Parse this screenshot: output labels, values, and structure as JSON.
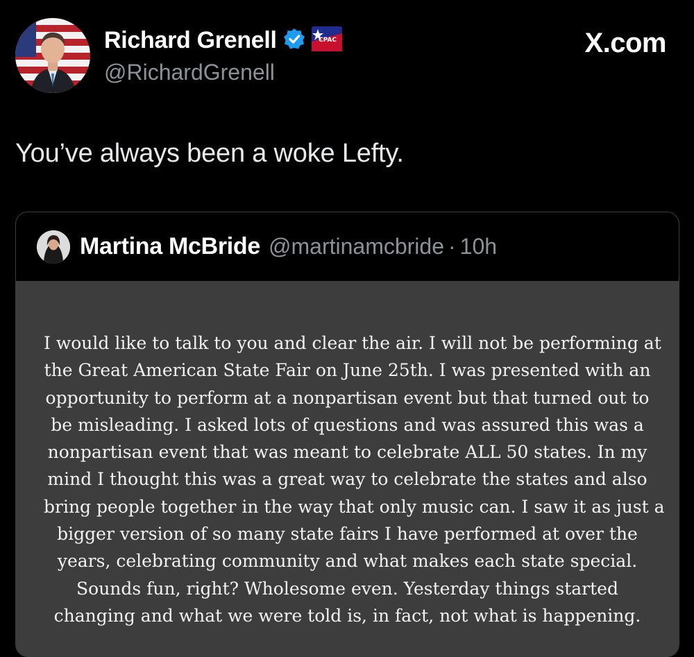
{
  "author": {
    "display_name": "Richard Grenell",
    "handle": "@RichardGrenell",
    "badge_icon": "verified-icon",
    "affiliation_icon": "cpac-icon",
    "affiliation_label": "CPAC"
  },
  "site": {
    "label": "X.com"
  },
  "tweet": {
    "text": "You’ve always been a woke Lefty."
  },
  "quoted": {
    "display_name": "Martina McBride",
    "handle": "@martinamcbride",
    "separator": "·",
    "time": "10h",
    "image_lines": [
      "I would like to talk to you and clear the air. I will not be performing at",
      "the Great American State Fair on June 25th. I was presented with an",
      "opportunity to perform at a nonpartisan event but that turned out to",
      "be misleading. I asked lots of questions and was assured this was a",
      "nonpartisan event that was meant to celebrate ALL 50 states.  In my",
      "mind I thought this was a great way to celebrate the states and also",
      "bring people together in the way that only music can. I saw it as just a",
      "bigger version of so many state fairs I have performed at over the",
      "years, celebrating community and what makes each state special.",
      "Sounds fun, right? Wholesome even. Yesterday things started",
      "changing and what we were told is, in fact, not what is happening."
    ]
  },
  "colors": {
    "background": "#000000",
    "verified_blue": "#1d9bf0",
    "secondary_text": "#8b9299",
    "quote_image_bg": "#3d3d3d"
  }
}
